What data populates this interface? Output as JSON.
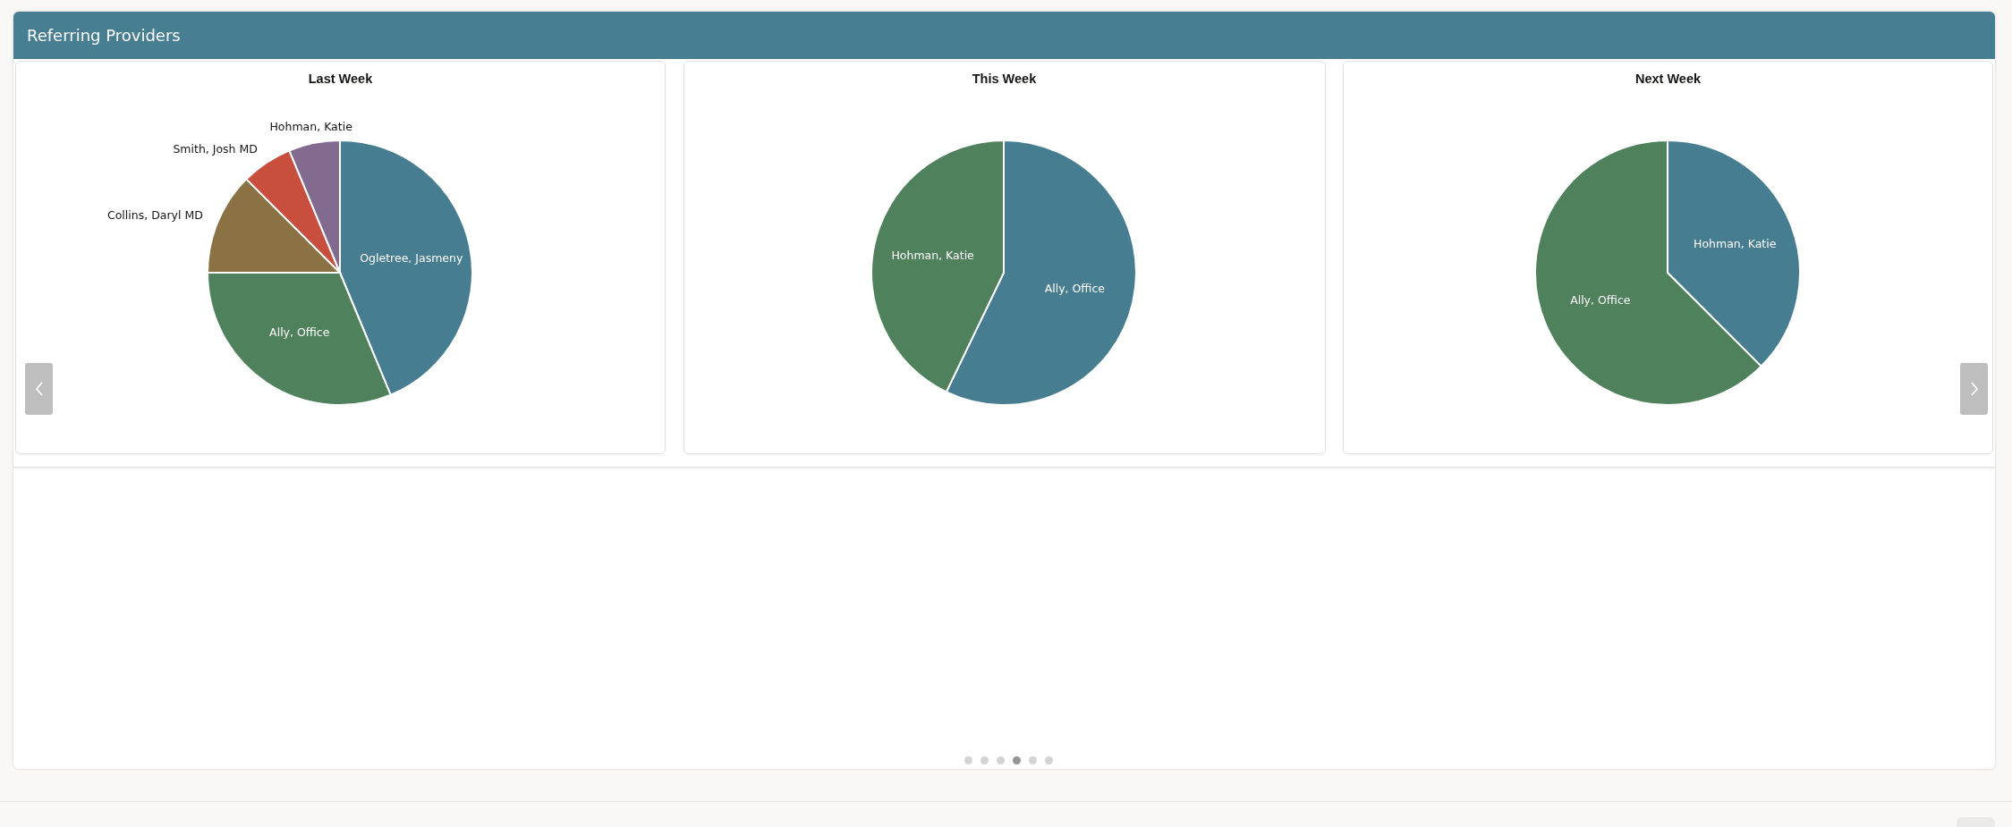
{
  "region": {
    "title": "Referring Providers"
  },
  "charts": [
    {
      "chart_data": {
        "type": "pie",
        "title": "Last Week",
        "categories": [
          "Ogletree, Jasmeny",
          "Ally, Office",
          "Collins, Daryl MD",
          "Smith, Josh MD",
          "Hohman, Katie"
        ],
        "series": [
          {
            "values": [
              43.75,
              31.25,
              12.5,
              6.25,
              6.25
            ]
          }
        ],
        "colors": [
          "#467d91",
          "#4f825c",
          "#8a7244",
          "#c84f3e",
          "#836b90"
        ]
      }
    },
    {
      "chart_data": {
        "type": "pie",
        "title": "This Week",
        "categories": [
          "Ally, Office",
          "Hohman, Katie"
        ],
        "series": [
          {
            "values": [
              57.14,
              42.86
            ]
          }
        ],
        "colors": [
          "#467d91",
          "#4f825c"
        ]
      }
    },
    {
      "chart_data": {
        "type": "pie",
        "title": "Next Week",
        "categories": [
          "Hohman, Katie",
          "Ally, Office"
        ],
        "series": [
          {
            "values": [
              37.5,
              62.5
            ]
          }
        ],
        "colors": [
          "#467d91",
          "#4f825c"
        ]
      }
    }
  ],
  "carousel": {
    "pages": [
      {
        "selected": false
      },
      {
        "selected": false
      },
      {
        "selected": false
      },
      {
        "selected": true
      },
      {
        "selected": false
      },
      {
        "selected": false
      }
    ]
  }
}
